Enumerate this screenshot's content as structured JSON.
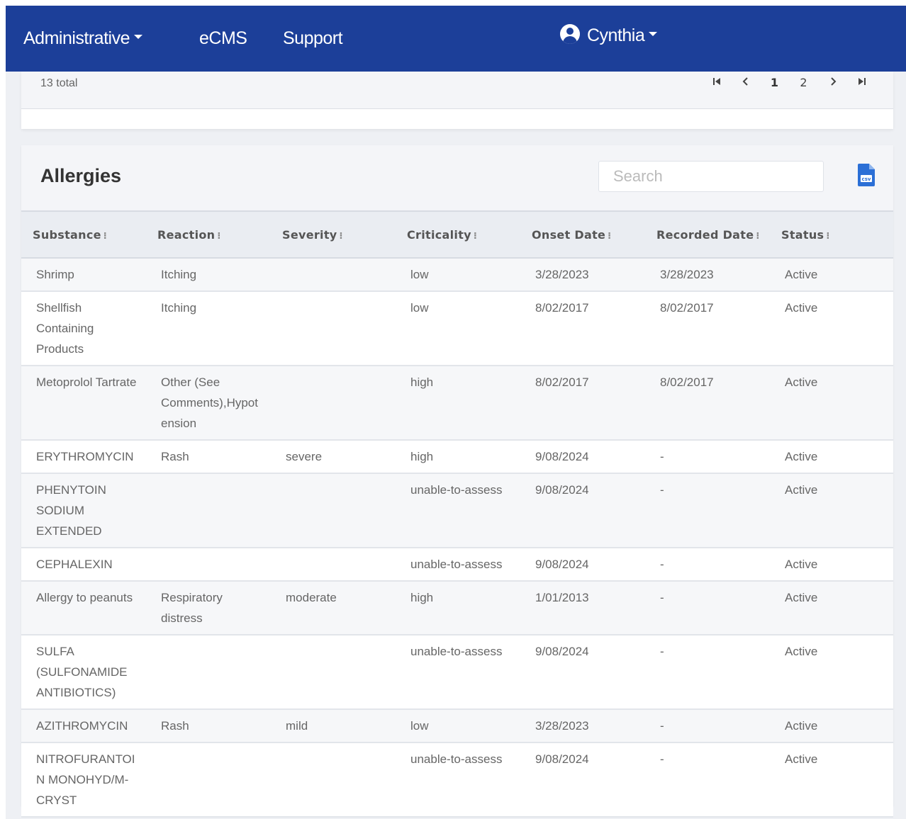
{
  "nav": {
    "administrative": "Administrative",
    "ecms": "eCMS",
    "support": "Support",
    "user": "Cynthia"
  },
  "pagination": {
    "total": "13 total",
    "first": "⏮",
    "prev": "‹",
    "page1": "1",
    "page2": "2",
    "next": "›",
    "last": "⏭"
  },
  "allergies": {
    "title": "Allergies",
    "search_placeholder": "Search",
    "export_icon": "csv-file-icon",
    "columns": [
      "Substance",
      "Reaction",
      "Severity",
      "Criticality",
      "Onset Date",
      "Recorded Date",
      "Status"
    ],
    "rows": [
      [
        "Shrimp",
        "Itching",
        "",
        "low",
        "3/28/2023",
        "3/28/2023",
        "Active"
      ],
      [
        "Shellfish Containing Products",
        "Itching",
        "",
        "low",
        "8/02/2017",
        "8/02/2017",
        "Active"
      ],
      [
        "Metoprolol Tartrate",
        "Other (See Comments),Hypotension",
        "",
        "high",
        "8/02/2017",
        "8/02/2017",
        "Active"
      ],
      [
        "ERYTHROMYCIN",
        "Rash",
        "severe",
        "high",
        "9/08/2024",
        "-",
        "Active"
      ],
      [
        "PHENYTOIN SODIUM EXTENDED",
        "",
        "",
        "unable-to-assess",
        "9/08/2024",
        "-",
        "Active"
      ],
      [
        "CEPHALEXIN",
        "",
        "",
        "unable-to-assess",
        "9/08/2024",
        "-",
        "Active"
      ],
      [
        "Allergy to peanuts",
        "Respiratory distress",
        "moderate",
        "high",
        "1/01/2013",
        "-",
        "Active"
      ],
      [
        "SULFA (SULFONAMIDE ANTIBIOTICS)",
        "",
        "",
        "unable-to-assess",
        "9/08/2024",
        "-",
        "Active"
      ],
      [
        "AZITHROMYCIN",
        "Rash",
        "mild",
        "low",
        "3/28/2023",
        "-",
        "Active"
      ],
      [
        "NITROFURANTOIN MONOHYD/M-CRYST",
        "",
        "",
        "unable-to-assess",
        "9/08/2024",
        "-",
        "Active"
      ]
    ]
  },
  "colors": {
    "nav_bg": "#1c3f99",
    "csv_icon": "#2b6fd6"
  }
}
